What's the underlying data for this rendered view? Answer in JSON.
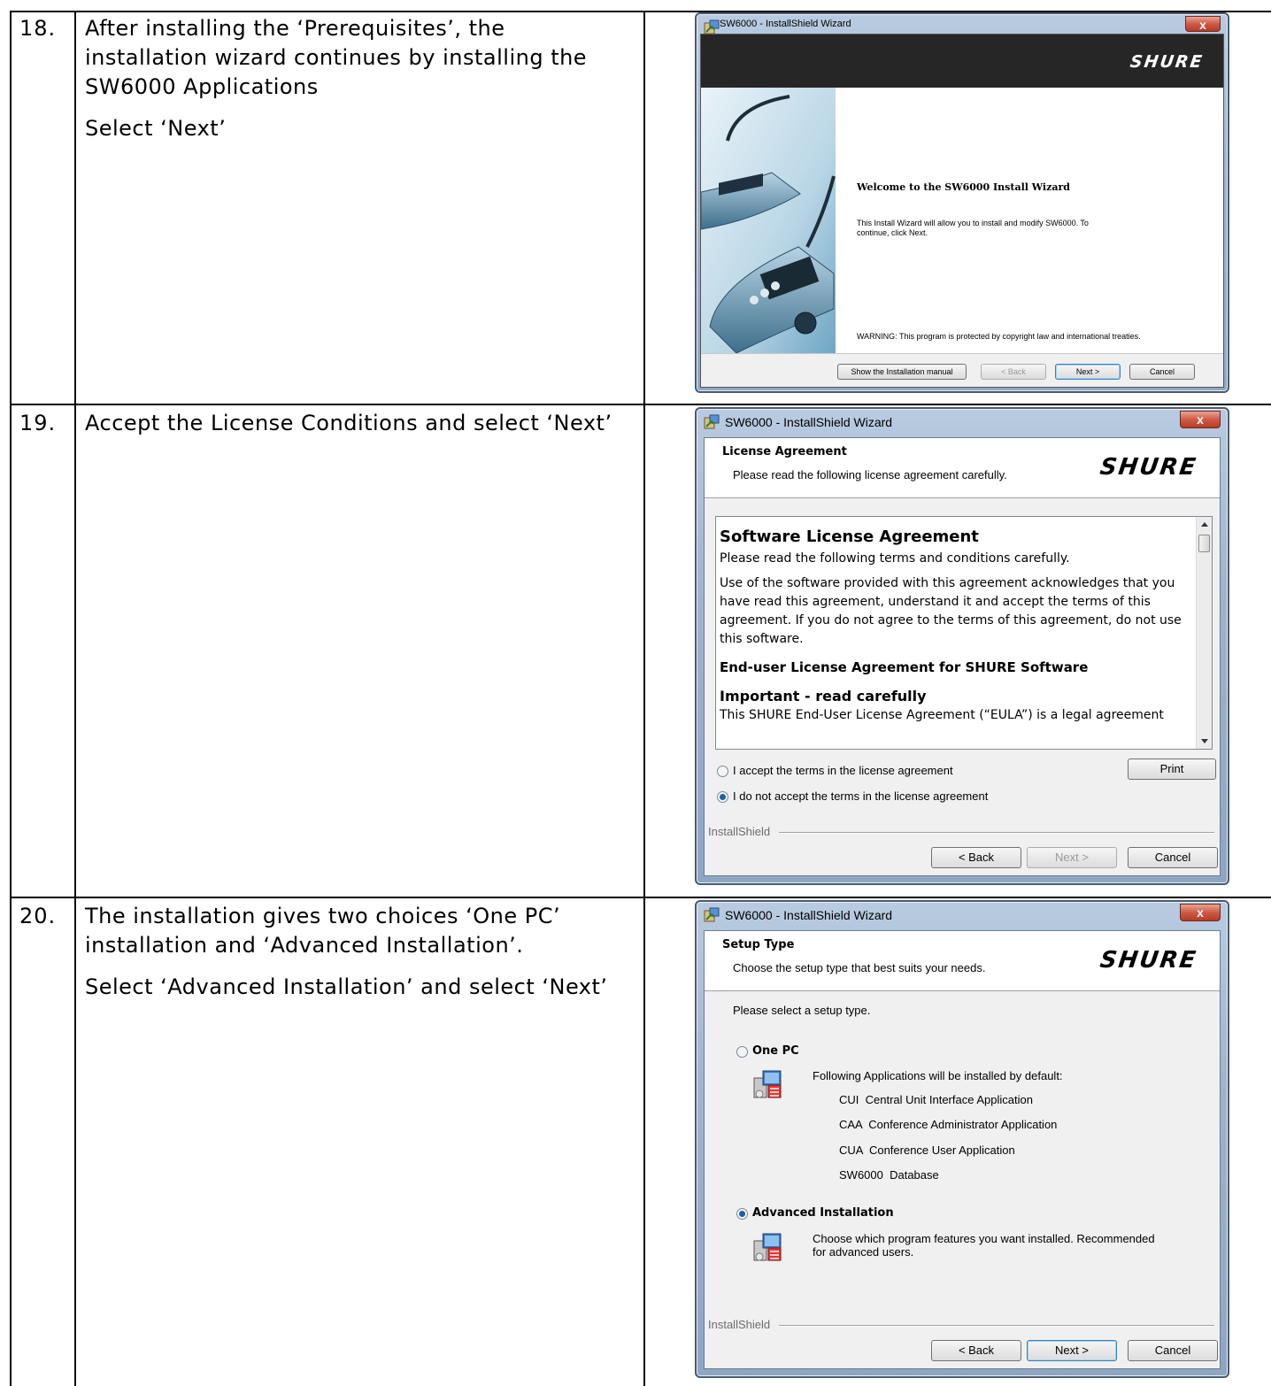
{
  "rows": [
    {
      "number": "18.",
      "paragraphs": [
        "After installing the ‘Prerequisites’, the installation wizard continues by installing the SW6000 Applications",
        "Select ‘Next’"
      ],
      "dialog": {
        "title": "SW6000 - InstallShield Wizard",
        "close_label": "x",
        "logo": "SHURE",
        "heading": "Welcome to the SW6000 Install Wizard",
        "body": "This Install Wizard will allow you to install and modify SW6000. To continue, click Next.",
        "warning": "WARNING: This program is protected by copyright law and international treaties.",
        "buttons": {
          "manual": "Show the Installation manual",
          "back": "< Back",
          "next": "Next >",
          "cancel": "Cancel"
        }
      }
    },
    {
      "number": "19.",
      "paragraphs": [
        "Accept the License Conditions and select ‘Next’"
      ],
      "dialog": {
        "title": "SW6000 - InstallShield Wizard",
        "close_label": "x",
        "logo": "SHURE",
        "header_title": "License Agreement",
        "header_sub": "Please read the following license agreement carefully.",
        "license": {
          "title": "Software License Agreement",
          "p1": "Please read the following terms and conditions carefully.",
          "p2": "Use of the software provided with this agreement acknowledges that you have read this agreement, understand it and accept the terms of this agreement. If you do not agree to the terms of this agreement, do not use this software.",
          "h2": "End-user License Agreement for SHURE Software",
          "h3": "Important - read carefully",
          "p3": "This SHURE End-User License Agreement (“EULA”) is a legal agreement"
        },
        "accept_label": "I accept the terms in the license agreement",
        "decline_label": "I do not accept the terms in the license agreement",
        "selected": "decline",
        "print_label": "Print",
        "brand": "InstallShield",
        "buttons": {
          "back": "< Back",
          "next": "Next >",
          "cancel": "Cancel"
        }
      }
    },
    {
      "number": "20.",
      "paragraphs": [
        "The installation gives two choices ‘One PC’ installation and ‘Advanced Installation’.",
        "Select ‘Advanced Installation’ and select ‘Next’"
      ],
      "dialog": {
        "title": "SW6000 - InstallShield Wizard",
        "close_label": "x",
        "logo": "SHURE",
        "header_title": "Setup Type",
        "header_sub": "Choose the setup type that best suits your needs.",
        "prompt": "Please select a setup type.",
        "option1": {
          "label": "One PC",
          "desc": "Following Applications will be installed by default:",
          "apps": [
            "CUI  Central Unit Interface Application",
            "CAA  Conference Administrator Application",
            "CUA  Conference User Application",
            "SW6000  Database"
          ]
        },
        "option2": {
          "label": "Advanced Installation",
          "desc": "Choose which program features you want installed. Recommended for advanced users."
        },
        "selected": "advanced",
        "brand": "InstallShield",
        "buttons": {
          "back": "< Back",
          "next": "Next >",
          "cancel": "Cancel"
        }
      }
    }
  ]
}
